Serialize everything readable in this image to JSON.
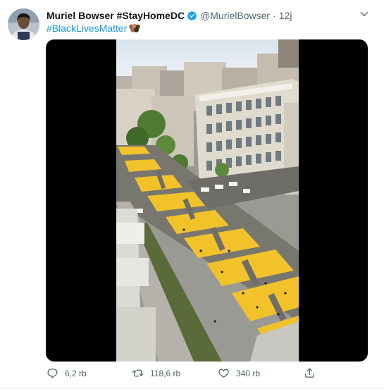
{
  "tweet": {
    "author_name": "Muriel Bowser #StayHomeDC",
    "handle": "@MurielBowser",
    "separator": "·",
    "time": "12j",
    "hashtag": "#BlackLivesMatter",
    "verified": true
  },
  "media": {
    "type": "video"
  },
  "actions": {
    "reply_count": "6,2 rb",
    "retweet_count": "118,6 rb",
    "like_count": "340 rb"
  },
  "colors": {
    "link": "#1b95e0",
    "verified": "#1da1f2",
    "muted": "#536471",
    "painted_street": "#f2c22b"
  },
  "icons": {
    "verified": "verified-badge-icon",
    "caret": "chevron-down-icon",
    "reply": "reply-icon",
    "retweet": "retweet-icon",
    "like": "heart-icon",
    "share": "share-icon"
  }
}
